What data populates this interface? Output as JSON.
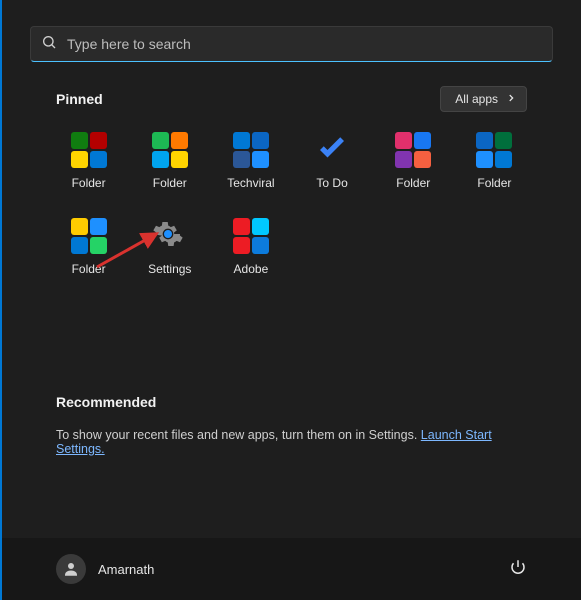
{
  "search": {
    "placeholder": "Type here to search"
  },
  "pinned": {
    "title": "Pinned",
    "all_apps": "All apps",
    "items": [
      {
        "label": "Folder",
        "kind": "quad",
        "colors": [
          "#107c10",
          "#b30000",
          "#ffd400",
          "#0078d4"
        ]
      },
      {
        "label": "Folder",
        "kind": "quad",
        "colors": [
          "#1db954",
          "#ff7a00",
          "#00a4ef",
          "#ffd400"
        ]
      },
      {
        "label": "Techviral",
        "kind": "quad",
        "colors": [
          "#0078d4",
          "#0b66c3",
          "#2b5797",
          "#1e90ff"
        ]
      },
      {
        "label": "To Do",
        "kind": "check",
        "colors": [
          "#3b82f6"
        ]
      },
      {
        "label": "Folder",
        "kind": "quad",
        "colors": [
          "#E1306C",
          "#1877f2",
          "#8134af",
          "#f56040"
        ]
      },
      {
        "label": "Folder",
        "kind": "quad",
        "colors": [
          "#0b66c3",
          "#006f3c",
          "#1e90ff",
          "#0078d4"
        ]
      },
      {
        "label": "Folder",
        "kind": "quad",
        "colors": [
          "#ffcc00",
          "#1e90ff",
          "#0078d4",
          "#25d366"
        ]
      },
      {
        "label": "Settings",
        "kind": "gear",
        "colors": [
          "#8a8a8a",
          "#1e90ff"
        ]
      },
      {
        "label": "Adobe",
        "kind": "quad",
        "colors": [
          "#ed1c24",
          "#00c8ff",
          "#ed1c24",
          "#0c7bdc"
        ]
      }
    ]
  },
  "recommended": {
    "title": "Recommended",
    "text": "To show your recent files and new apps, turn them on in Settings. ",
    "link": "Launch Start Settings."
  },
  "footer": {
    "user": "Amarnath"
  },
  "annotation": {
    "arrow_target": "settings"
  }
}
